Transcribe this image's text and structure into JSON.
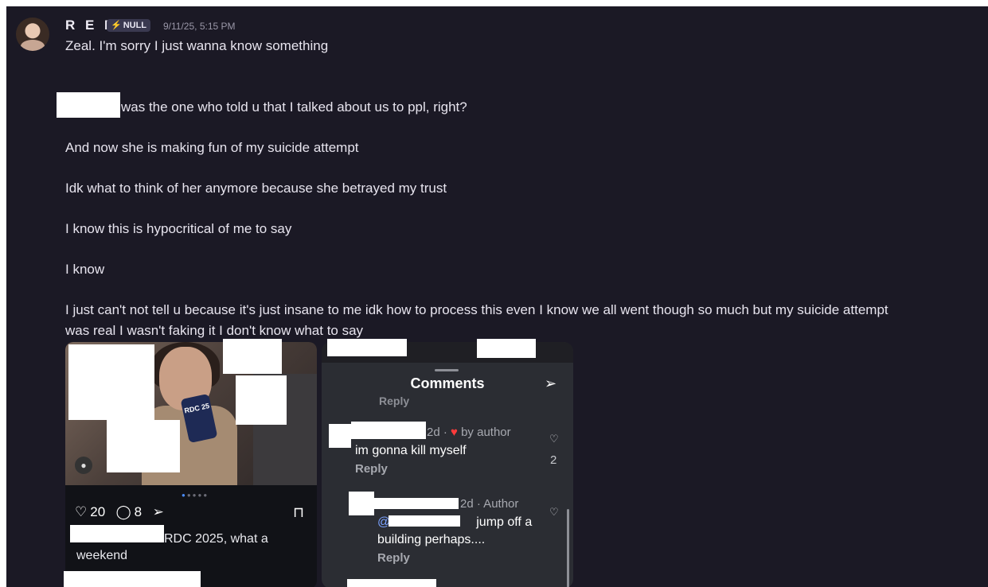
{
  "message": {
    "username": "R E N",
    "badge": "NULL",
    "timestamp": "9/11/25, 5:15 PM",
    "lines": [
      "Zeal. I'm sorry I just wanna know something",
      "was the one who told u that I talked about us to ppl, right?",
      "And now she is making fun of my suicide attempt",
      "Idk what to think of her anymore because she betrayed my trust",
      "I know this is hypocritical of me to say",
      "I know",
      "I just can't not tell u because it's just insane to me idk how to process this even I know we all went though so much but my suicide attempt",
      "was real I wasn't faking it I don't know what to say"
    ]
  },
  "post": {
    "phone_label": "RDC 25",
    "likes": "20",
    "comments": "8",
    "caption_rest": "RDC 2025, what a",
    "caption_line2": "weekend"
  },
  "comments_panel": {
    "title": "Comments",
    "ghost_reply": "Reply",
    "comment1": {
      "meta": "2d · ",
      "meta_by": " by author",
      "text": "im gonna kill myself",
      "reply": "Reply",
      "like_count": "2"
    },
    "comment2": {
      "meta": "2d · Author",
      "mention": "@",
      "text_a": "jump off a",
      "text_b": "building perhaps....",
      "reply": "Reply"
    }
  }
}
